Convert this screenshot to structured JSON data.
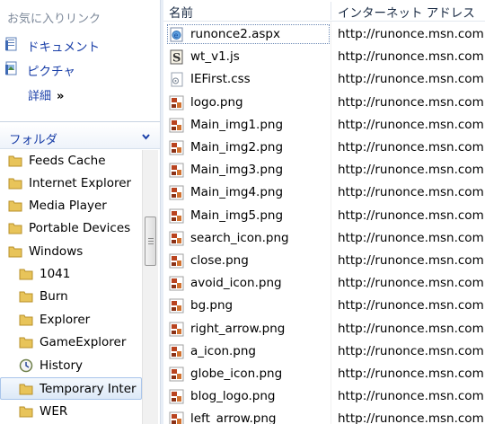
{
  "favorites": {
    "header": "お気に入りリンク",
    "items": [
      {
        "label": "ドキュメント",
        "icon": "documents-icon"
      },
      {
        "label": "ピクチャ",
        "icon": "pictures-icon"
      }
    ],
    "more_label": "詳細",
    "more_chevron": "»"
  },
  "folders": {
    "title": "フォルダ",
    "tree": [
      {
        "label": "Feeds Cache",
        "icon": "folder-icon"
      },
      {
        "label": "Internet Explorer",
        "icon": "folder-icon"
      },
      {
        "label": "Media Player",
        "icon": "folder-icon"
      },
      {
        "label": "Portable Devices",
        "icon": "folder-icon"
      },
      {
        "label": "Windows",
        "icon": "folder-icon"
      },
      {
        "label": "1041",
        "icon": "folder-icon"
      },
      {
        "label": "Burn",
        "icon": "folder-icon"
      },
      {
        "label": "Explorer",
        "icon": "folder-icon"
      },
      {
        "label": "GameExplorer",
        "icon": "folder-icon"
      },
      {
        "label": "History",
        "icon": "history-icon"
      },
      {
        "label": "Temporary Inter",
        "icon": "folder-icon",
        "selected": true
      },
      {
        "label": "WER",
        "icon": "folder-icon"
      }
    ]
  },
  "file_list": {
    "columns": [
      "名前",
      "インターネット アドレス"
    ],
    "rows": [
      {
        "name": "runonce2.aspx",
        "url": "http://runonce.msn.com",
        "icon": "web-page-icon"
      },
      {
        "name": "wt_v1.js",
        "url": "http://runonce.msn.com",
        "icon": "script-file-icon"
      },
      {
        "name": "IEFirst.css",
        "url": "http://runonce.msn.com",
        "icon": "css-file-icon"
      },
      {
        "name": "logo.png",
        "url": "http://runonce.msn.com",
        "icon": "image-file-icon"
      },
      {
        "name": "Main_img1.png",
        "url": "http://runonce.msn.com",
        "icon": "image-file-icon"
      },
      {
        "name": "Main_img2.png",
        "url": "http://runonce.msn.com",
        "icon": "image-file-icon"
      },
      {
        "name": "Main_img3.png",
        "url": "http://runonce.msn.com",
        "icon": "image-file-icon"
      },
      {
        "name": "Main_img4.png",
        "url": "http://runonce.msn.com",
        "icon": "image-file-icon"
      },
      {
        "name": "Main_img5.png",
        "url": "http://runonce.msn.com",
        "icon": "image-file-icon"
      },
      {
        "name": "search_icon.png",
        "url": "http://runonce.msn.com",
        "icon": "image-file-icon"
      },
      {
        "name": "close.png",
        "url": "http://runonce.msn.com",
        "icon": "image-file-icon"
      },
      {
        "name": "avoid_icon.png",
        "url": "http://runonce.msn.com",
        "icon": "image-file-icon"
      },
      {
        "name": "bg.png",
        "url": "http://runonce.msn.com",
        "icon": "image-file-icon"
      },
      {
        "name": "right_arrow.png",
        "url": "http://runonce.msn.com",
        "icon": "image-file-icon"
      },
      {
        "name": "a_icon.png",
        "url": "http://runonce.msn.com",
        "icon": "image-file-icon"
      },
      {
        "name": "globe_icon.png",
        "url": "http://runonce.msn.com",
        "icon": "image-file-icon"
      },
      {
        "name": "blog_logo.png",
        "url": "http://runonce.msn.com",
        "icon": "image-file-icon"
      },
      {
        "name": "left_arrow.png",
        "url": "http://runonce.msn.com",
        "icon": "image-file-icon"
      }
    ]
  },
  "colors": {
    "link_blue": "#1a3fa8",
    "header_gray": "#7c8899",
    "selection_border": "#a9c5ea",
    "folder_yellow": "#e8c45a"
  }
}
